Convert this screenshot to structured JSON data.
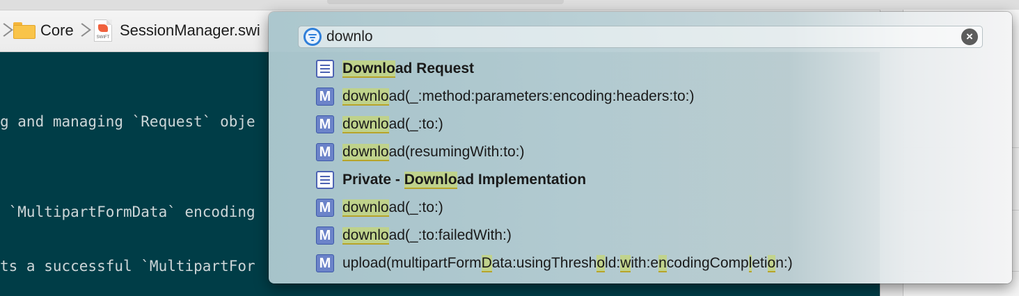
{
  "jumpbar": {
    "folder_label": "Core",
    "file_label": "SessionManager.swi",
    "file_icon_text": "SWIFT"
  },
  "code": {
    "lines": [
      "g and managing `Request` obje",
      " `MultipartFormData` encoding",
      "ts a successful `MultipartFor"
    ]
  },
  "quick_open": {
    "query": "downlo",
    "results": [
      {
        "kind": "mark",
        "icon": "mark-icon",
        "segments": [
          {
            "t": "Downlo",
            "h": true
          },
          {
            "t": "ad Request",
            "h": false
          }
        ],
        "bold": true
      },
      {
        "kind": "method",
        "icon": "method-icon",
        "segments": [
          {
            "t": "downlo",
            "h": true
          },
          {
            "t": "ad(_:method:parameters:encoding:headers:to:)",
            "h": false
          }
        ],
        "bold": false
      },
      {
        "kind": "method",
        "icon": "method-icon",
        "segments": [
          {
            "t": "downlo",
            "h": true
          },
          {
            "t": "ad(_:to:)",
            "h": false
          }
        ],
        "bold": false
      },
      {
        "kind": "method",
        "icon": "method-icon",
        "segments": [
          {
            "t": "downlo",
            "h": true
          },
          {
            "t": "ad(resumingWith:to:)",
            "h": false
          }
        ],
        "bold": false
      },
      {
        "kind": "mark",
        "icon": "mark-icon",
        "segments": [
          {
            "t": "Private - ",
            "h": false
          },
          {
            "t": "Downlo",
            "h": true
          },
          {
            "t": "ad Implementation",
            "h": false
          }
        ],
        "bold": true
      },
      {
        "kind": "method",
        "icon": "method-icon",
        "segments": [
          {
            "t": "downlo",
            "h": true
          },
          {
            "t": "ad(_:to:)",
            "h": false
          }
        ],
        "bold": false
      },
      {
        "kind": "method",
        "icon": "method-icon",
        "segments": [
          {
            "t": "downlo",
            "h": true
          },
          {
            "t": "ad(_:to:failedWith:)",
            "h": false
          }
        ],
        "bold": false
      },
      {
        "kind": "method",
        "icon": "method-icon",
        "segments": [
          {
            "t": "upload(multipartForm",
            "h": false
          },
          {
            "t": "D",
            "h": true
          },
          {
            "t": "ata:usingThresh",
            "h": false
          },
          {
            "t": "o",
            "h": true
          },
          {
            "t": "ld:",
            "h": false
          },
          {
            "t": "w",
            "h": true
          },
          {
            "t": "ith:e",
            "h": false
          },
          {
            "t": "n",
            "h": true
          },
          {
            "t": "codingComp",
            "h": false
          },
          {
            "t": "l",
            "h": true
          },
          {
            "t": "eti",
            "h": false
          },
          {
            "t": "o",
            "h": true
          },
          {
            "t": "n:)",
            "h": false
          }
        ],
        "bold": false
      }
    ]
  },
  "method_glyph": "M",
  "clear_glyph": "×"
}
